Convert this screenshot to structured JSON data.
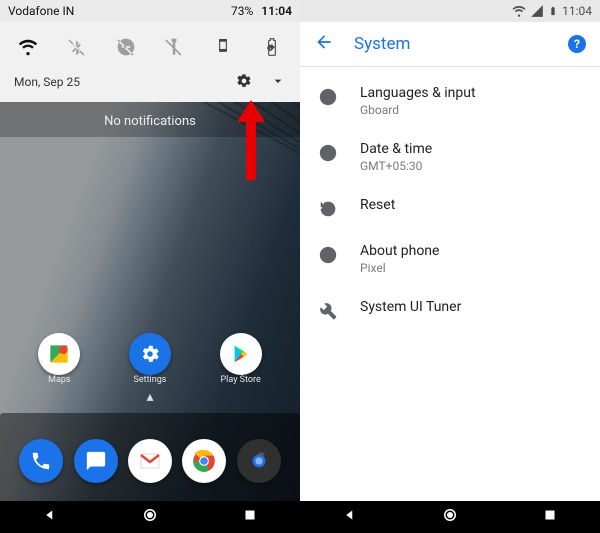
{
  "left": {
    "status": {
      "carrier": "Vodafone IN",
      "battery_pct": "73%",
      "time": "11:04"
    },
    "qs_date": "Mon, Sep 25",
    "no_notifications_label": "No notifications",
    "apps_row1": [
      {
        "label": "Maps"
      },
      {
        "label": "Settings"
      },
      {
        "label": "Play Store"
      }
    ]
  },
  "right": {
    "status": {
      "time": "11:04"
    },
    "header_title": "System",
    "items": [
      {
        "title": "Languages & input",
        "subtitle": "Gboard"
      },
      {
        "title": "Date & time",
        "subtitle": "GMT+05:30"
      },
      {
        "title": "Reset",
        "subtitle": ""
      },
      {
        "title": "About phone",
        "subtitle": "Pixel"
      },
      {
        "title": "System UI Tuner",
        "subtitle": ""
      }
    ]
  }
}
